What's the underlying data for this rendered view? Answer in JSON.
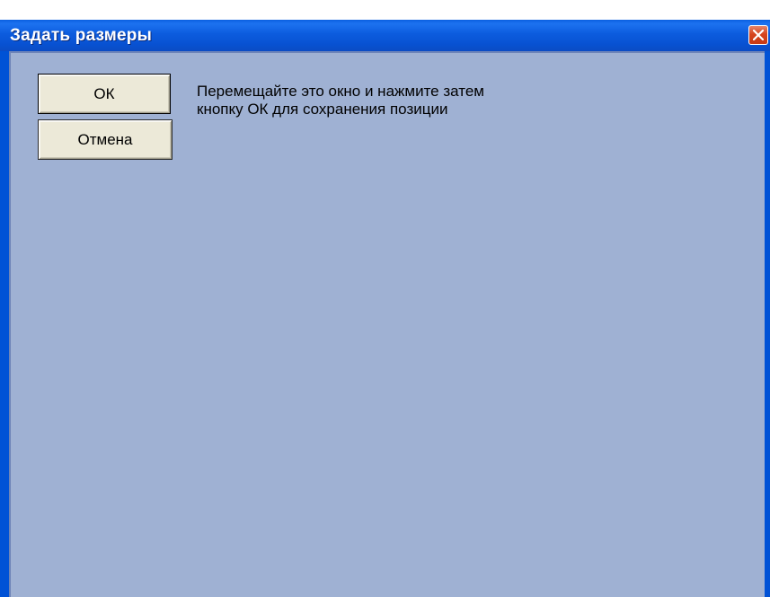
{
  "window": {
    "title": "Задать размеры"
  },
  "buttons": {
    "ok_label": "ОК",
    "cancel_label": "Отмена"
  },
  "message": {
    "line1": "Перемещайте это окно и нажмите затем",
    "line2": "кнопку ОК для сохранения позиции"
  },
  "colors": {
    "titlebar": "#0a5fe0",
    "client_background": "#9fb1d3",
    "close_button": "#d6451f",
    "button_face": "#ece9d8"
  },
  "icons": {
    "close": "close-icon"
  }
}
